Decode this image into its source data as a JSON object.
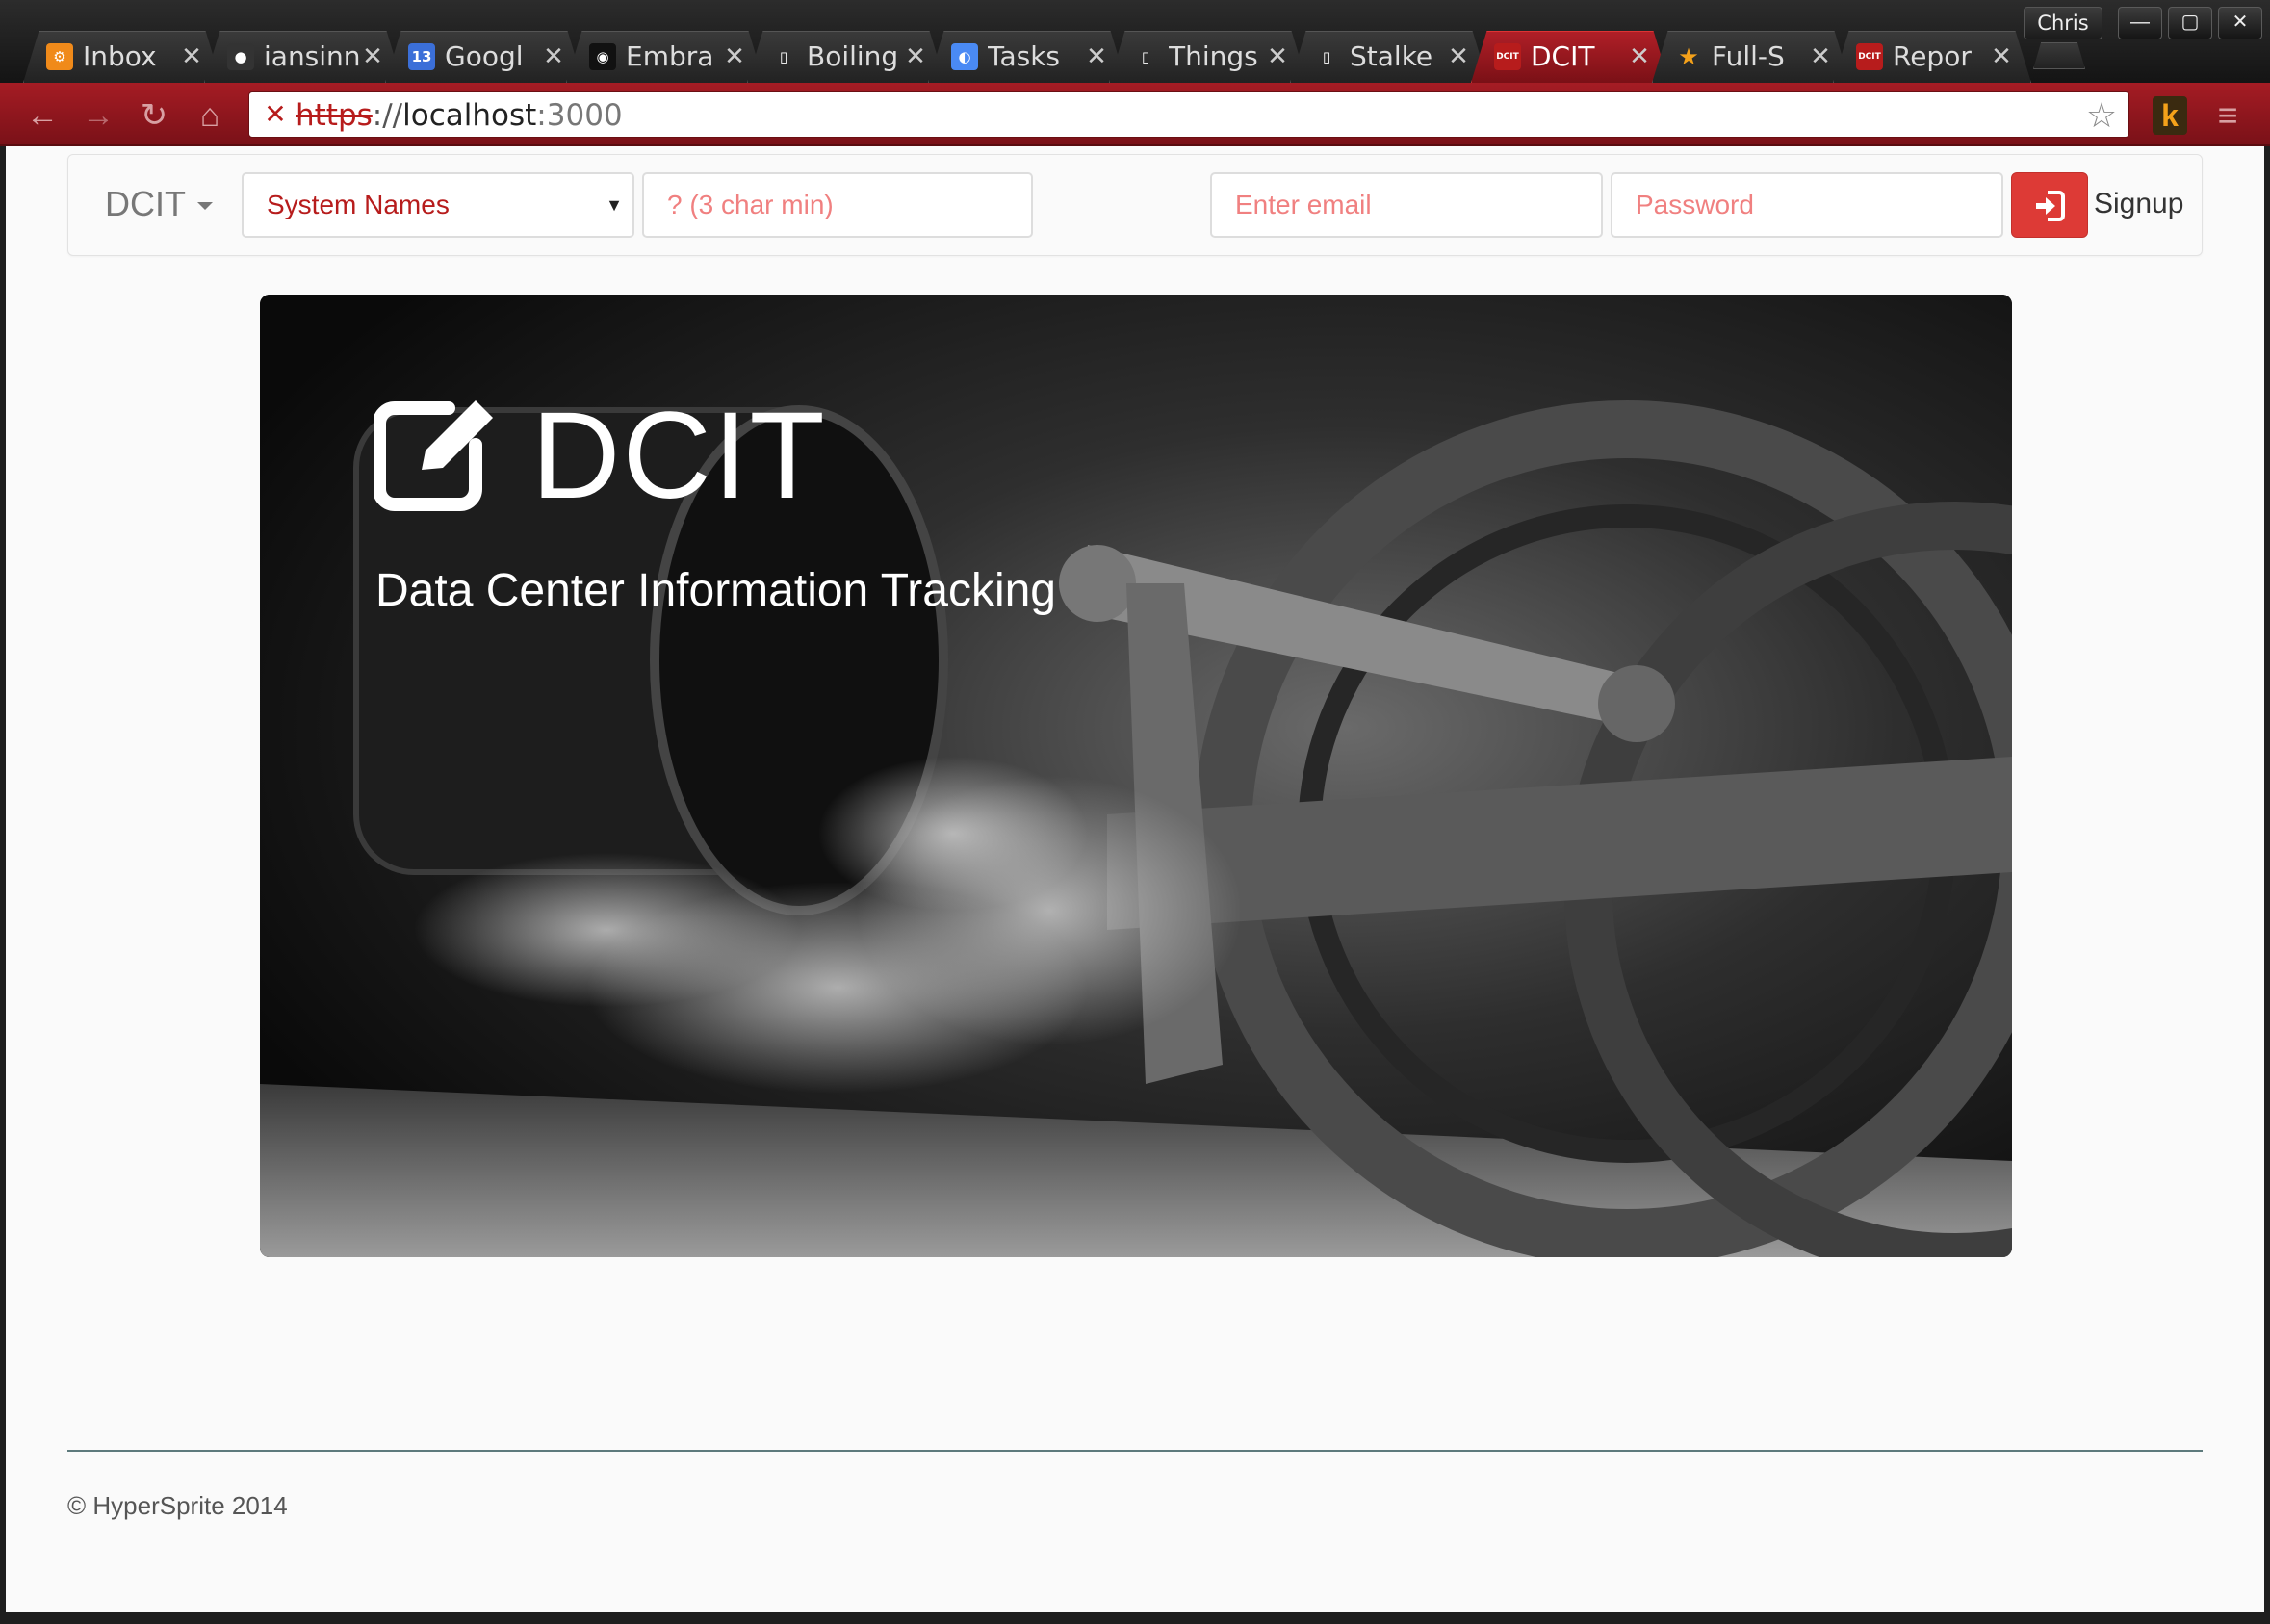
{
  "window": {
    "user_name": "Chris",
    "controls": {
      "minimize": "—",
      "maximize": "▢",
      "close": "✕"
    }
  },
  "tabs": [
    {
      "title": "Inbox",
      "favicon_text": "⚙",
      "favicon_color": "#f08a1a",
      "active": false
    },
    {
      "title": "iansinn",
      "favicon_text": "●",
      "favicon_color": "#333333",
      "active": false
    },
    {
      "title": "Googl",
      "favicon_text": "13",
      "favicon_color": "#3b6fd8",
      "active": false
    },
    {
      "title": "Embra",
      "favicon_text": "◉",
      "favicon_color": "#111111",
      "active": false
    },
    {
      "title": "Boiling",
      "favicon_text": "▯",
      "favicon_color": "transparent",
      "active": false
    },
    {
      "title": "Tasks",
      "favicon_text": "◐",
      "favicon_color": "#4a8af4",
      "active": false
    },
    {
      "title": "Things",
      "favicon_text": "▯",
      "favicon_color": "transparent",
      "active": false
    },
    {
      "title": "Stalke",
      "favicon_text": "▯",
      "favicon_color": "transparent",
      "active": false
    },
    {
      "title": "DCIT",
      "favicon_text": "DCIT",
      "favicon_color": "#b71c1c",
      "active": true
    },
    {
      "title": "Full-S",
      "favicon_text": "★",
      "favicon_color": "transparent",
      "active": false
    },
    {
      "title": "Repor",
      "favicon_text": "DCIT",
      "favicon_color": "#b71c1c",
      "active": false
    }
  ],
  "tab_close_glyph": "✕",
  "toolbar": {
    "back": "←",
    "forward": "→",
    "reload": "↻",
    "home": "⌂",
    "url_insecure_icon": "✕",
    "url_scheme": "https",
    "url_sep": "://",
    "url_host": "localhost",
    "url_port": ":3000",
    "bookmark_star": "☆",
    "extension_label": "k",
    "menu_glyph": "≡"
  },
  "navbar": {
    "brand": "DCIT",
    "system_select": {
      "selected": "System Names",
      "arrow": "▼"
    },
    "search": {
      "placeholder": "? (3 char min)"
    },
    "email": {
      "placeholder": "Enter email"
    },
    "password": {
      "placeholder": "Password"
    },
    "signup_label": "Signup"
  },
  "hero": {
    "title": "DCIT",
    "tagline": "Data Center Information Tracking"
  },
  "footer": {
    "copyright": "© HyperSprite 2014"
  },
  "colors": {
    "accent_red": "#dd3a36",
    "toolbar_red": "#a51c24",
    "placeholder_pink": "#f08080",
    "select_text_red": "#b71c1c",
    "footer_rule": "#5d7a7c"
  }
}
